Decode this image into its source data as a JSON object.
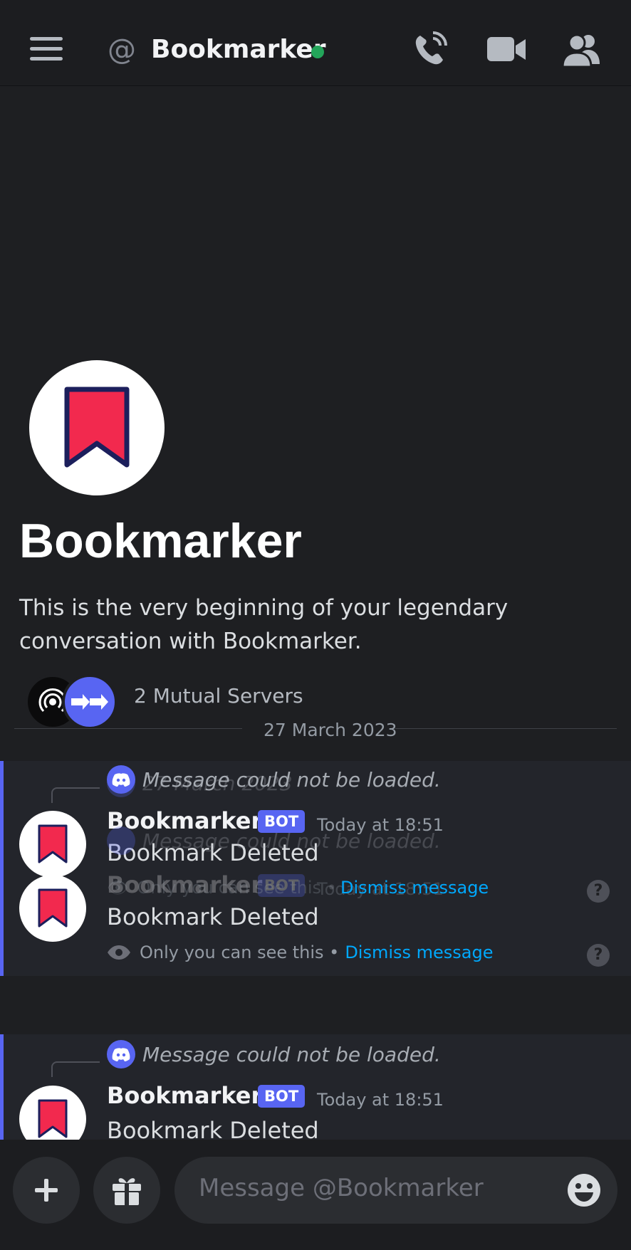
{
  "header": {
    "at_symbol": "@",
    "title": "Bookmarker",
    "status": "online",
    "icons": [
      "hamburger-menu-icon",
      "phone-call-icon",
      "video-camera-icon",
      "members-icon"
    ]
  },
  "intro": {
    "name": "Bookmarker",
    "text": "This is the very beginning of your legendary conversation with Bookmarker.",
    "mutual_servers": "2 Mutual Servers"
  },
  "date_divider": "27 March 2023",
  "messages": [
    {
      "reply_text": "Message could not be loaded.",
      "author": "Bookmarker",
      "tag": "BOT",
      "timestamp": "Today at 18:51",
      "body": "Bookmark Deleted",
      "only_you": "Only you can see this •",
      "dismiss": "Dismiss message",
      "help": "?"
    },
    {
      "reply_text": "Message could not be loaded.",
      "author": "Bookmarker",
      "tag": "BOT",
      "timestamp": "Today at 18:51",
      "body": "Bookmark Deleted",
      "only_you": "Only you can see this •",
      "dismiss": "Dismiss message",
      "help": "?"
    },
    {
      "reply_text": "Message could not be loaded.",
      "author": "Bookmarker",
      "tag": "BOT",
      "timestamp": "Today at 18:51",
      "body": "Bookmark Deleted"
    }
  ],
  "input": {
    "placeholder": "Message @Bookmarker"
  },
  "colors": {
    "accent": "#5865f2",
    "online": "#23a55a",
    "link": "#00a8fc",
    "bookmark_red": "#f2294e",
    "bookmark_outline": "#1c1f5c"
  }
}
